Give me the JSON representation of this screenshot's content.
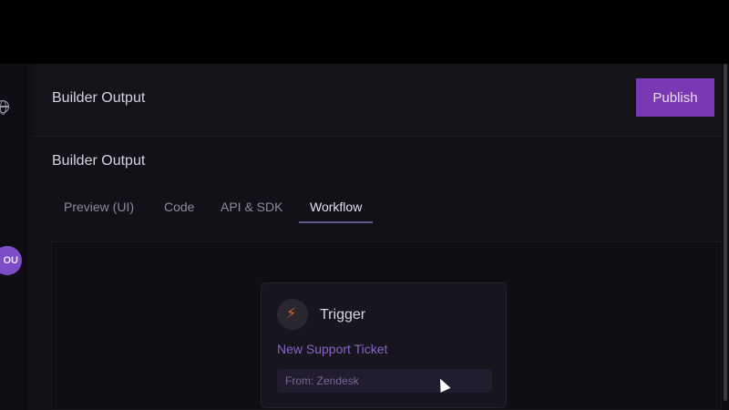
{
  "header": {
    "title": "Builder Output",
    "publish_label": "Publish"
  },
  "sidebar": {
    "avatar_initials": "OU",
    "icons": [
      "globe-icon",
      "avatar"
    ]
  },
  "panel": {
    "title": "Builder Output",
    "tabs": [
      {
        "label": "Preview (UI)",
        "active": false
      },
      {
        "label": "Code",
        "active": false
      },
      {
        "label": "API & SDK",
        "active": false
      },
      {
        "label": "Workflow",
        "active": true
      }
    ]
  },
  "workflow": {
    "node": {
      "type": "Trigger",
      "title": "New Support Ticket",
      "source": "From: Zendesk",
      "icon": "trigger-icon"
    }
  },
  "colors": {
    "accent": "#7a38b3",
    "node_title": "#8a63c9",
    "trigger_icon": "#e0612b"
  }
}
